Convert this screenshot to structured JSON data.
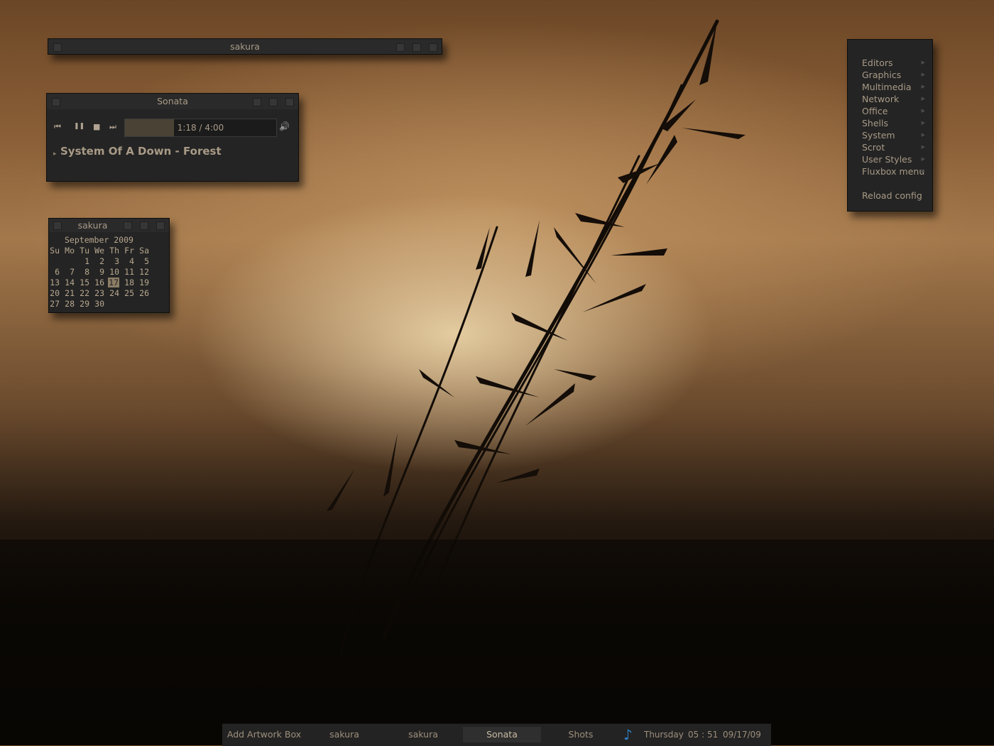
{
  "terminal_window": {
    "title": "sakura"
  },
  "player": {
    "title": "Sonata",
    "controls": {
      "prev": "⏮",
      "pause": "❚❚",
      "stop": "■",
      "next": "⏭",
      "volume": "🔊"
    },
    "progress": {
      "text": "1:18 / 4:00",
      "fraction": 0.325
    },
    "song": "System Of A Down - Forest",
    "expander": "▸"
  },
  "calendar": {
    "title": "sakura",
    "month_label": "September 2009",
    "weekdays": [
      "Su",
      "Mo",
      "Tu",
      "We",
      "Th",
      "Fr",
      "Sa"
    ],
    "weeks": [
      [
        "",
        "",
        "1",
        "2",
        "3",
        "4",
        "5"
      ],
      [
        "6",
        "7",
        "8",
        "9",
        "10",
        "11",
        "12"
      ],
      [
        "13",
        "14",
        "15",
        "16",
        "17",
        "18",
        "19"
      ],
      [
        "20",
        "21",
        "22",
        "23",
        "24",
        "25",
        "26"
      ],
      [
        "27",
        "28",
        "29",
        "30",
        "",
        "",
        ""
      ]
    ],
    "today": "17"
  },
  "root_menu": {
    "items": [
      {
        "label": "Editors",
        "submenu": true
      },
      {
        "label": "Graphics",
        "submenu": true
      },
      {
        "label": "Multimedia",
        "submenu": true
      },
      {
        "label": "Network",
        "submenu": true
      },
      {
        "label": "Office",
        "submenu": true
      },
      {
        "label": "Shells",
        "submenu": true
      },
      {
        "label": "System",
        "submenu": true
      },
      {
        "label": "Scrot",
        "submenu": true
      },
      {
        "label": "User Styles",
        "submenu": true
      },
      {
        "label": "Fluxbox menu",
        "submenu": true
      },
      {
        "label": "Reload config",
        "submenu": false
      }
    ]
  },
  "taskbar": {
    "tasks": [
      {
        "label": "Add Artwork Box",
        "active": false
      },
      {
        "label": "sakura",
        "active": false
      },
      {
        "label": "sakura",
        "active": false
      },
      {
        "label": "Sonata",
        "active": true
      },
      {
        "label": "Shots",
        "active": false
      }
    ],
    "tray_icon": "music-note-icon",
    "day": "Thursday",
    "time": "05 : 51",
    "date": "09/17/09"
  },
  "colors": {
    "panel_bg": "#242424",
    "text": "#b8a88f",
    "tray_icon": "#2f7fc4",
    "today_bg": "#8c7d66"
  }
}
